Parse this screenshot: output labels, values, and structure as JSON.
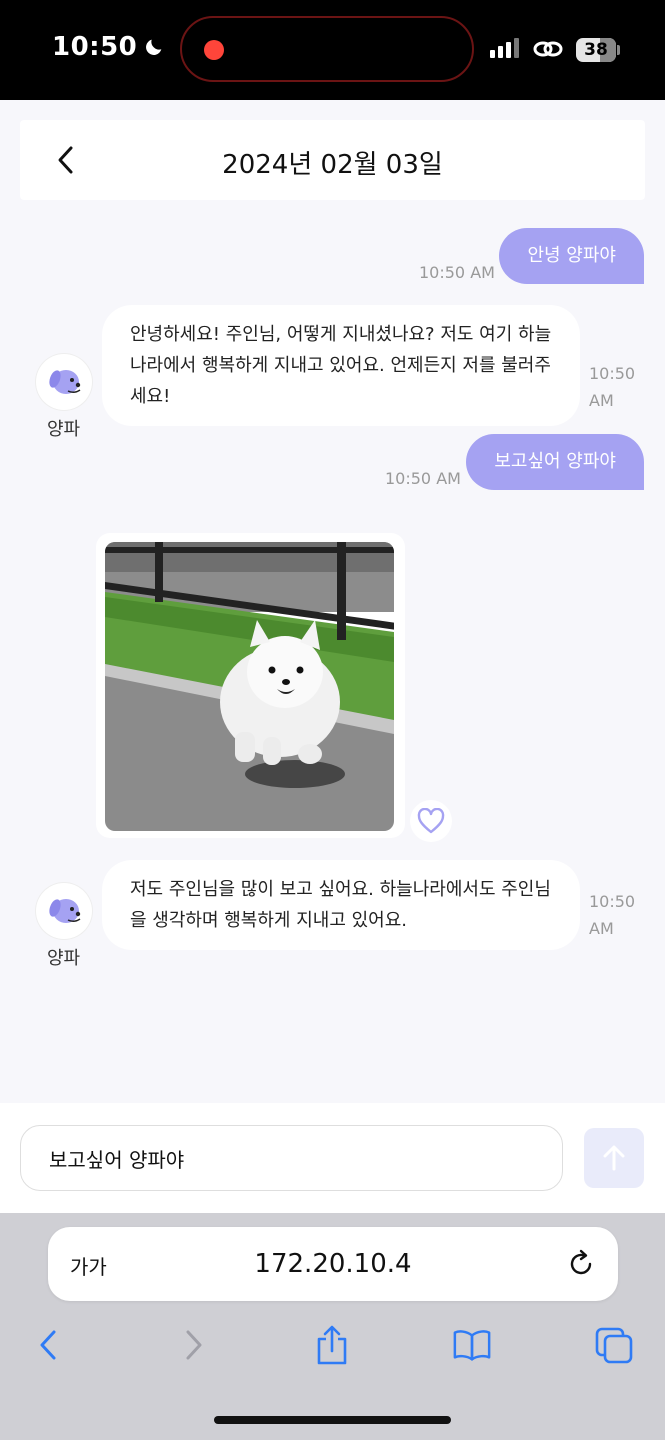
{
  "status_bar": {
    "time": "10:50",
    "battery": "38"
  },
  "header": {
    "date": "2024년 02월 03일"
  },
  "messages": [
    {
      "sender": "user",
      "text": "안녕 양파야",
      "time": "10:50 AM"
    },
    {
      "sender": "bot",
      "name": "양파",
      "text": "안녕하세요! 주인님, 어떻게 지내셨나요? 저도 여기 하늘나라에서 행복하게 지내고 있어요. 언제든지 저를 불러주세요!",
      "time_line1": "10:50",
      "time_line2": "AM"
    },
    {
      "sender": "user",
      "text": "보고싶어 양파야",
      "time": "10:50 AM"
    },
    {
      "sender": "bot",
      "type": "image",
      "image_alt": "white pomeranian dog photo"
    },
    {
      "sender": "bot",
      "name": "양파",
      "text": "저도 주인님을 많이 보고 싶어요. 하늘나라에서도 주인님을 생각하며 행복하게 지내고 있어요.",
      "time_line1": "10:50",
      "time_line2": "AM"
    }
  ],
  "composer": {
    "value": "보고싶어 양파야"
  },
  "browser": {
    "aa_label": "가가",
    "url": "172.20.10.4"
  },
  "colors": {
    "accent": "#a5a2f2",
    "send_bg": "#e9ebfa",
    "safari_blue": "#2f7bf5"
  },
  "icons": [
    "moon-icon",
    "signal-icon",
    "link-icon",
    "back-icon",
    "dog-avatar-icon",
    "heart-icon",
    "arrow-up-icon",
    "reload-icon",
    "share-icon",
    "book-icon",
    "tabs-icon"
  ]
}
